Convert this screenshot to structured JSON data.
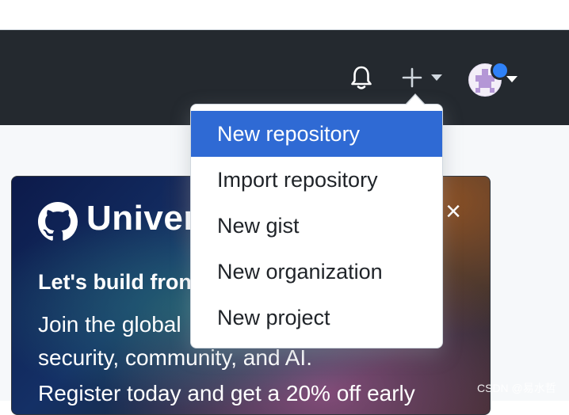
{
  "header": {
    "icons": [
      "bell-icon",
      "plus-icon",
      "caret-down-icon",
      "avatar"
    ],
    "colors": {
      "background": "#24292f",
      "notification_dot": "#2f81f7"
    }
  },
  "create_menu": {
    "items": [
      {
        "label": "New repository",
        "active": true
      },
      {
        "label": "Import repository",
        "active": false
      },
      {
        "label": "New gist",
        "active": false
      },
      {
        "label": "New organization",
        "active": false
      },
      {
        "label": "New project",
        "active": false
      }
    ],
    "colors": {
      "active_bg": "#2f6ad4",
      "text": "#1f2328"
    }
  },
  "banner": {
    "brand": "Univer",
    "heading": "Let's build fron",
    "body_lines": [
      "Join the global                                     d,",
      "security, community, and AI."
    ],
    "body_cutoff": "Register today and get a 20% off early",
    "close_icon": "×"
  },
  "watermark": "CSDN @易水哲"
}
